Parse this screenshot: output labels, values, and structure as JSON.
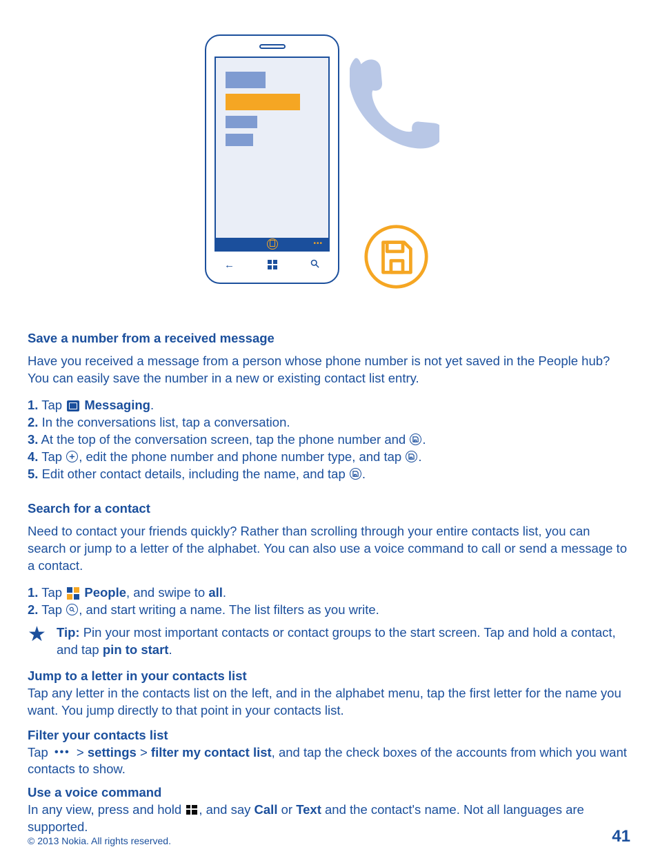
{
  "section1": {
    "heading": "Save a number from a received message",
    "intro": "Have you received a message from a person whose phone number is not yet saved in the People hub? You can easily save the number in a new or existing contact list entry.",
    "steps": {
      "s1_num": "1.",
      "s1_a": " Tap ",
      "s1_b": " Messaging",
      "s1_c": ".",
      "s2_num": "2.",
      "s2": " In the conversations list, tap a conversation.",
      "s3_num": "3.",
      "s3_a": " At the top of the conversation screen, tap the phone number and ",
      "s3_b": ".",
      "s4_num": "4.",
      "s4_a": " Tap ",
      "s4_b": ", edit the phone number and phone number type, and tap ",
      "s4_c": ".",
      "s5_num": "5.",
      "s5_a": " Edit other contact details, including the name, and tap ",
      "s5_b": "."
    }
  },
  "section2": {
    "heading": "Search for a contact",
    "intro": "Need to contact your friends quickly? Rather than scrolling through your entire contacts list, you can search or jump to a letter of the alphabet. You can also use a voice command to call or send a message to a contact.",
    "steps": {
      "s1_num": "1.",
      "s1_a": " Tap ",
      "s1_b": " People",
      "s1_c": ", and swipe to ",
      "s1_d": "all",
      "s1_e": ".",
      "s2_num": "2.",
      "s2_a": " Tap ",
      "s2_b": ", and start writing a name. The list filters as you write."
    },
    "tip_label": "Tip:",
    "tip_a": " Pin your most important contacts or contact groups to the start screen. Tap and hold a contact, and tap ",
    "tip_b": "pin to start",
    "tip_c": "."
  },
  "section3": {
    "heading": "Jump to a letter in your contacts list",
    "body": "Tap any letter in the contacts list on the left, and in the alphabet menu, tap the first letter for the name you want. You jump directly to that point in your contacts list."
  },
  "section4": {
    "heading": "Filter your contacts list",
    "a": "Tap ",
    "b": " > ",
    "c": "settings",
    "d": " > ",
    "e": "filter my contact list",
    "f": ", and tap the check boxes of the accounts from which you want contacts to show."
  },
  "section5": {
    "heading": "Use a voice command",
    "a": "In any view, press and hold ",
    "b": ", and say ",
    "c": "Call",
    "d": " or ",
    "e": "Text",
    "f": " and the contact's name. Not all languages are supported."
  },
  "footer": {
    "copyright": "© 2013 Nokia. All rights reserved.",
    "page": "41"
  }
}
